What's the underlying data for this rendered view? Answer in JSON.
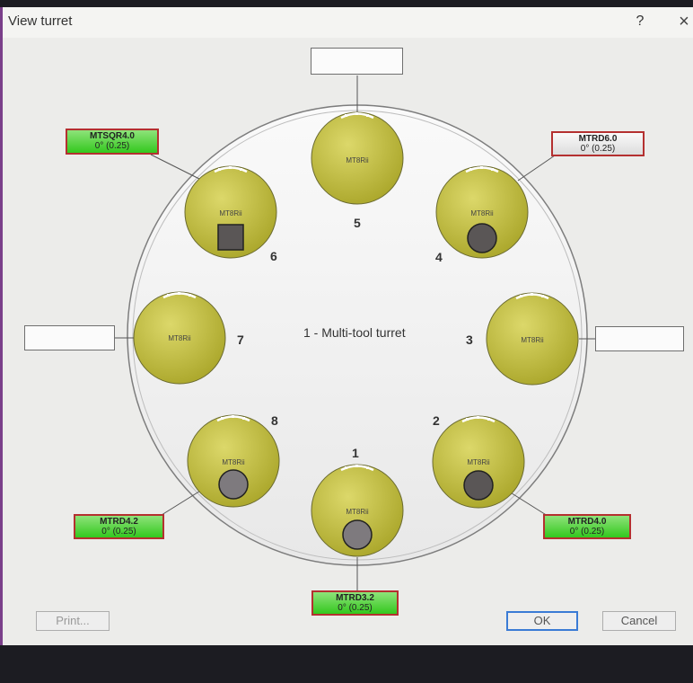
{
  "window": {
    "title": "View turret",
    "help_label": "?",
    "close_label": "×"
  },
  "turret": {
    "title": "1 - Multi-tool turret",
    "stations": [
      {
        "number": "1",
        "tool_type": "MT8Rii"
      },
      {
        "number": "2",
        "tool_type": "MT8Rii"
      },
      {
        "number": "3",
        "tool_type": "MT8Rii"
      },
      {
        "number": "4",
        "tool_type": "MT8Rii"
      },
      {
        "number": "5",
        "tool_type": "MT8Rii"
      },
      {
        "number": "6",
        "tool_type": "MT8Rii"
      },
      {
        "number": "7",
        "tool_type": "MT8Rii"
      },
      {
        "number": "8",
        "tool_type": "MT8Rii"
      }
    ]
  },
  "tool_labels": {
    "s1": {
      "tool": "MTRD3.2",
      "angle": "0° (0.25)"
    },
    "s2": {
      "tool": "MTRD4.0",
      "angle": "0° (0.25)"
    },
    "s4": {
      "tool": "MTRD6.0",
      "angle": "0° (0.25)"
    },
    "s6": {
      "tool": "MTSQR4.0",
      "angle": "0° (0.25)"
    },
    "s8": {
      "tool": "MTRD4.2",
      "angle": "0° (0.25)"
    }
  },
  "buttons": {
    "print": "Print...",
    "ok": "OK",
    "cancel": "Cancel"
  },
  "colors": {
    "tool_label_green": "#33c81e",
    "tool_label_border": "#b43030",
    "station_fill": "#c8c43a",
    "ok_border": "#3a7bd5"
  }
}
